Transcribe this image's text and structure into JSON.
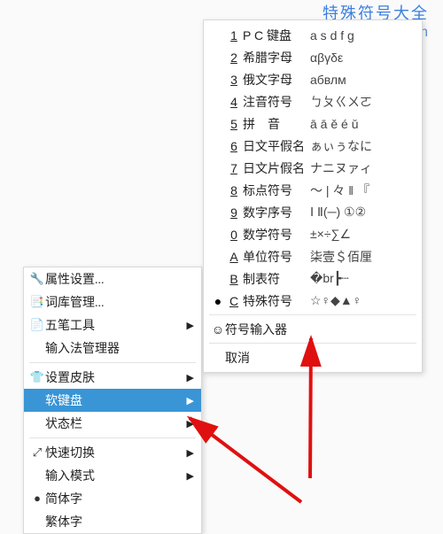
{
  "watermark": {
    "line1": "特殊符号大全",
    "line2": "www.tsfhdq.cn"
  },
  "left_menu": {
    "groups": [
      {
        "items": [
          {
            "icon": "🔧",
            "label": "属性设置...",
            "name": "menu-properties"
          },
          {
            "icon": "📑",
            "label": "词库管理...",
            "name": "menu-dict"
          },
          {
            "icon": "📄",
            "label": "五笔工具",
            "name": "menu-wubi-tools",
            "submenu": true
          },
          {
            "icon": "",
            "label": "输入法管理器",
            "name": "menu-ime-manager"
          }
        ]
      },
      {
        "items": [
          {
            "icon": "👕",
            "label": "设置皮肤",
            "name": "menu-skin",
            "submenu": true
          },
          {
            "icon": "",
            "label": "软键盘",
            "name": "menu-softkeyboard",
            "submenu": true,
            "highlight": true
          },
          {
            "icon": "",
            "label": "状态栏",
            "name": "menu-statusbar",
            "submenu": true
          }
        ]
      },
      {
        "items": [
          {
            "icon": "⤢",
            "label": "快速切换",
            "name": "menu-quickswitch",
            "submenu": true
          },
          {
            "icon": "",
            "label": "输入模式",
            "name": "menu-inputmode",
            "submenu": true
          },
          {
            "icon": "●",
            "label": "简体字",
            "name": "menu-simplified"
          },
          {
            "icon": "",
            "label": "繁体字",
            "name": "menu-traditional"
          }
        ]
      }
    ]
  },
  "right_menu": {
    "items": [
      {
        "key": "1",
        "name": "P C 键盘",
        "sample": "a s d f g",
        "id": "sk-pc"
      },
      {
        "key": "2",
        "name": "希腊字母",
        "sample": "αβγδε",
        "id": "sk-greek"
      },
      {
        "key": "3",
        "name": "俄文字母",
        "sample": "абвлм",
        "id": "sk-russian"
      },
      {
        "key": "4",
        "name": "注音符号",
        "sample": "ㄅㄆㄍㄨㄛ",
        "id": "sk-zhuyin"
      },
      {
        "key": "5",
        "name": "拼　音",
        "sample": "ā ā ě é ǔ",
        "id": "sk-pinyin"
      },
      {
        "key": "6",
        "name": "日文平假名",
        "sample": "ぁぃぅなに",
        "id": "sk-hiragana"
      },
      {
        "key": "7",
        "name": "日文片假名",
        "sample": "ナニヌァィ",
        "id": "sk-katakana"
      },
      {
        "key": "8",
        "name": "标点符号",
        "sample": "～ | 々 ‖ 『",
        "id": "sk-punct"
      },
      {
        "key": "9",
        "name": "数字序号",
        "sample": "Ⅰ Ⅱ(─) ①②",
        "id": "sk-numseq"
      },
      {
        "key": "0",
        "name": "数学符号",
        "sample": "±×÷∑∠",
        "id": "sk-math"
      },
      {
        "key": "A",
        "name": "单位符号",
        "sample": "柒壹＄佰厘",
        "id": "sk-unit"
      },
      {
        "key": "B",
        "name": "制表符",
        "sample": "�br┣┄",
        "id": "sk-boxdraw"
      },
      {
        "key": "C",
        "name": "特殊符号",
        "sample": "☆♀◆▲♀",
        "id": "sk-special",
        "radio": true
      }
    ],
    "symbol_input": {
      "icon": "☺",
      "label": "符号输入器",
      "id": "sk-symbol-input"
    },
    "cancel": {
      "label": "取消",
      "id": "sk-cancel"
    }
  }
}
